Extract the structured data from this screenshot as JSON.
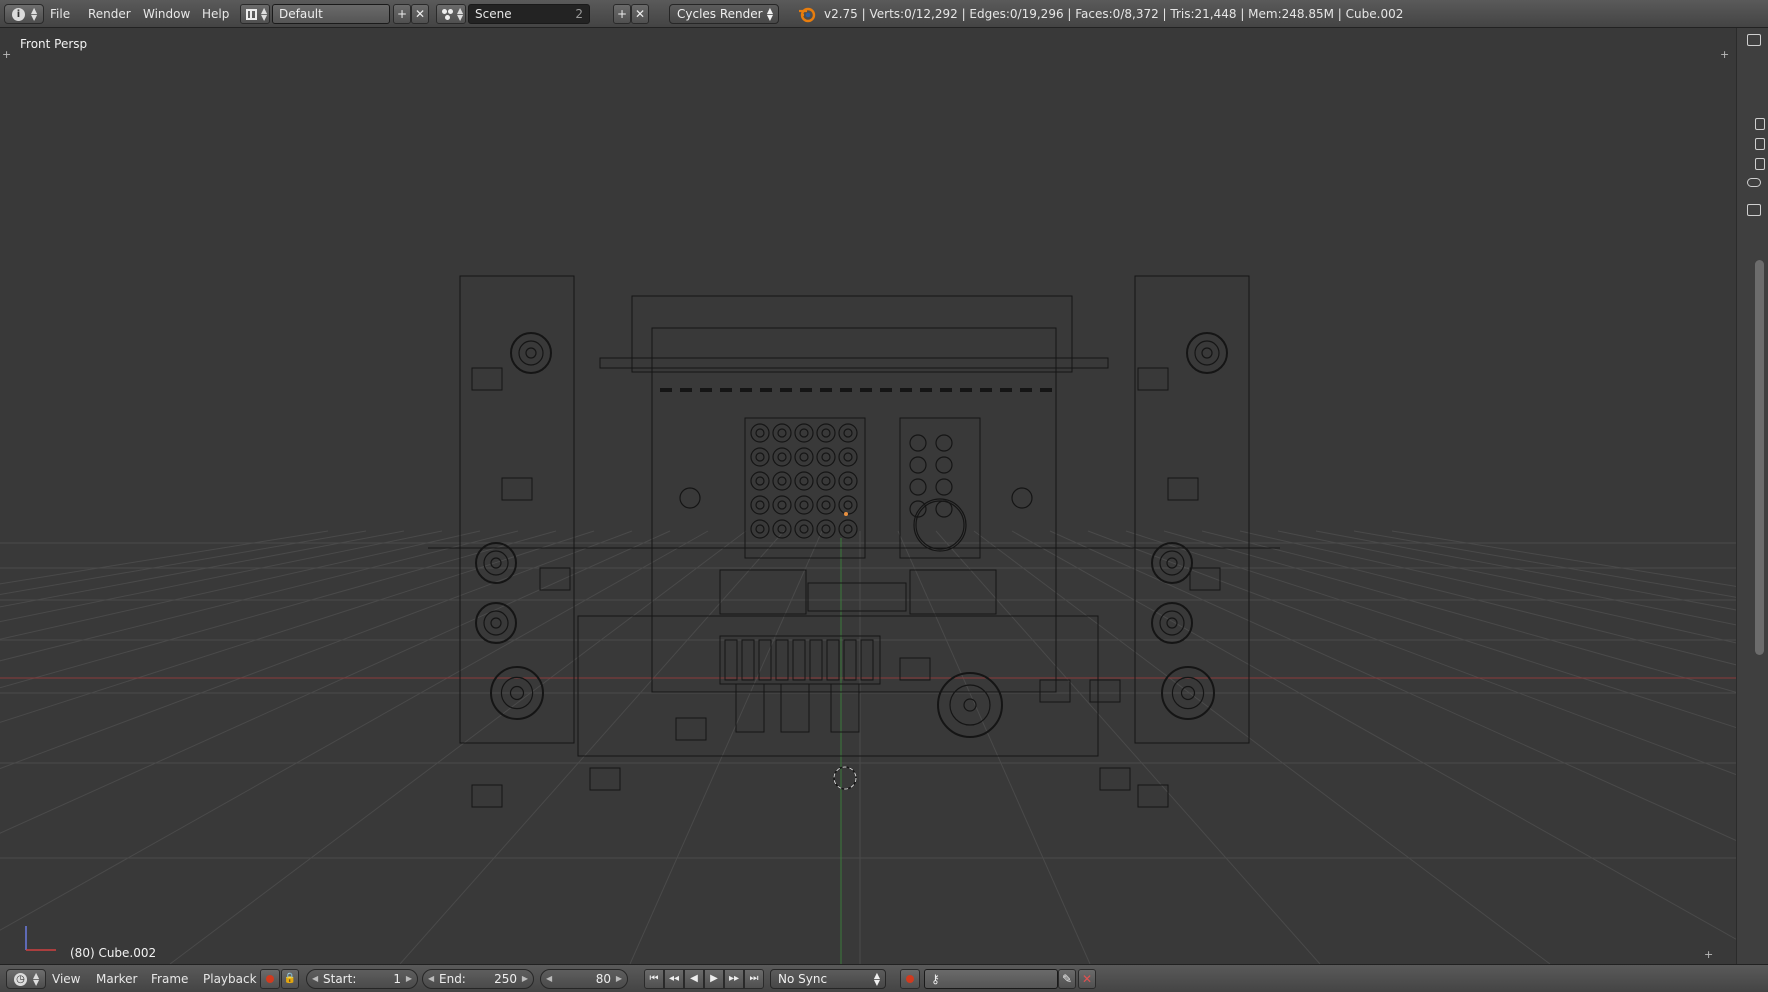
{
  "header": {
    "editor_icon": "info-icon",
    "menus": [
      "File",
      "Render",
      "Window",
      "Help"
    ],
    "screen_layout": "Default",
    "scene": "Scene",
    "scene_users": "2",
    "render_engine": "Cycles Render",
    "stats": "v2.75 | Verts:0/12,292 | Edges:0/19,296 | Faces:0/8,372 | Tris:21,448 | Mem:248.85M | Cube.002"
  },
  "viewport": {
    "view_label": "Front Persp",
    "object_label": "(80) Cube.002",
    "shading": "wireframe",
    "colors": {
      "background": "#393939",
      "grid": "#4a4a4a",
      "x_axis": "#8c3a3a",
      "y_axis": "#3c7a3c",
      "wire": "#151515"
    }
  },
  "timeline": {
    "menus": [
      "View",
      "Marker",
      "Frame",
      "Playback"
    ],
    "start_label": "Start:",
    "start_value": "1",
    "end_label": "End:",
    "end_value": "250",
    "current_frame": "80",
    "sync": "No Sync"
  }
}
